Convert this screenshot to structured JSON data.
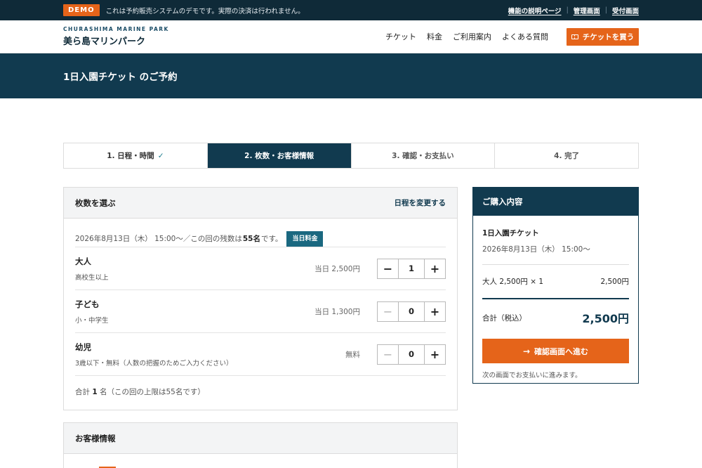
{
  "demo_bar": {
    "badge": "DEMO",
    "notice": "これは予約販売システムのデモです。実際の決済は行われません。",
    "links": [
      "機能の説明ページ",
      "管理画面",
      "受付画面"
    ]
  },
  "header": {
    "logo_en": "CHURASHIMA MARINE PARK",
    "logo_jp": "美ら島マリンパーク",
    "nav": [
      "チケット",
      "料金",
      "ご利用案内",
      "よくある質問"
    ],
    "buy_button": "チケットを買う"
  },
  "banner": {
    "title": "1日入園チケット のご予約"
  },
  "steps": [
    {
      "label": "1. 日程・時間",
      "check": "✓"
    },
    {
      "label": "2. 枚数・お客様情報"
    },
    {
      "label": "3. 確認・お支払い"
    },
    {
      "label": "4. 完了"
    }
  ],
  "quantity_panel": {
    "title": "枚数を選ぶ",
    "change_link": "日程を変更する",
    "session_prefix": "2026年8月13日（木） 15:00〜／この回の残数は",
    "remaining": "55名",
    "session_suffix": "です。",
    "badge": "当日料金",
    "tickets": [
      {
        "name": "大人",
        "desc": "高校生以上",
        "price": "当日 2,500円",
        "qty": "1",
        "minus": "−",
        "plus": "+"
      },
      {
        "name": "子ども",
        "desc": "小・中学生",
        "price": "当日 1,300円",
        "qty": "0",
        "minus": "−",
        "plus": "+"
      },
      {
        "name": "幼児",
        "desc": "3歳以下・無料（人数の把握のためご入力ください）",
        "price": "無料",
        "qty": "0",
        "minus": "−",
        "plus": "+"
      }
    ],
    "total_prefix": "合計",
    "total_count": "1",
    "total_suffix": "名（この回の上限は55名です）"
  },
  "customer_panel": {
    "title": "お客様情報"
  },
  "summary": {
    "title": "ご購入内容",
    "ticket": "1日入園チケット",
    "date": "2026年8月13日（木） 15:00〜",
    "line_label": "大人 2,500円 × 1",
    "line_amount": "2,500円",
    "total_label": "合計（税込）",
    "total_amount": "2,500円",
    "confirm_button": "確認画面へ進む",
    "note": "次の画面でお支払いに進みます。"
  },
  "colors": {
    "navy": "#113a4f",
    "orange": "#e5641a",
    "teal": "#1a6880"
  }
}
